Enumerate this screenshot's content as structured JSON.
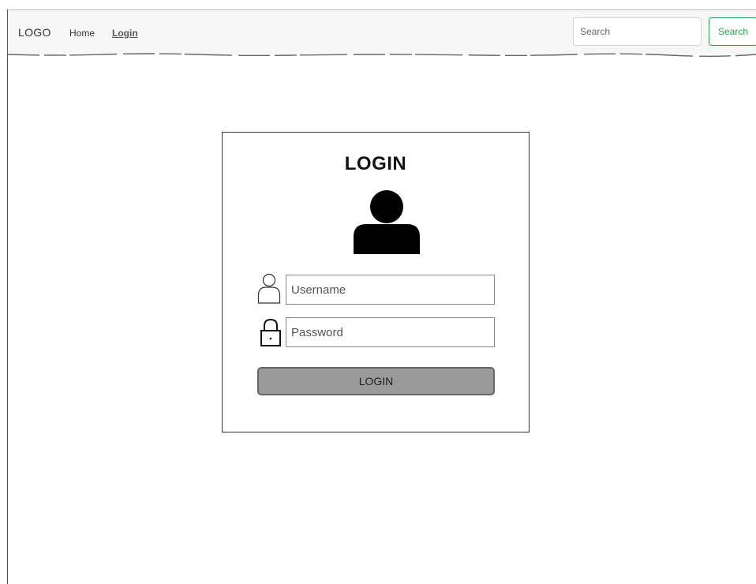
{
  "navbar": {
    "logo": "LOGO",
    "links": [
      {
        "label": "Home"
      },
      {
        "label": "Login"
      }
    ],
    "search": {
      "placeholder": "Search",
      "button_label": "Search"
    }
  },
  "login_card": {
    "title": "LOGIN",
    "avatar_icon": "user-silhouette-icon",
    "username": {
      "icon": "user-outline-icon",
      "placeholder": "Username",
      "value": ""
    },
    "password": {
      "icon": "lock-icon",
      "placeholder": "Password",
      "value": ""
    },
    "submit_label": "LOGIN"
  },
  "colors": {
    "search_button": "#2e9e4f",
    "login_button_fill": "#9a9a9a",
    "navbar_bg": "#f7f7f8"
  }
}
